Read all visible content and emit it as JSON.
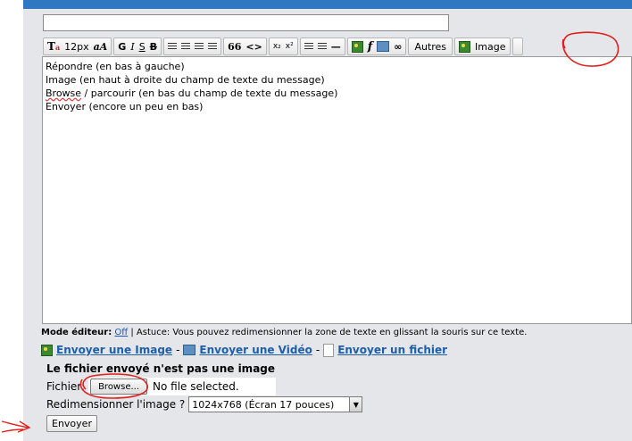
{
  "toolbar": {
    "font_size_label": "12px",
    "more_label": "Autres",
    "image_label": "Image",
    "quote_glyph": "66",
    "code_glyph": "<>",
    "subscript_glyph": "x₂",
    "superscript_glyph": "x²"
  },
  "editor": {
    "lines": [
      "Répondre (en bas à gauche)",
      "Image (en haut à droite du champ de texte du message)",
      "Browse",
      " / parcourir (en bas du champ de texte du message)",
      "Envoyer (encore un peu en bas)"
    ]
  },
  "astuce": {
    "mode_label": "Mode éditeur:",
    "mode_value": "Off",
    "tip_text": "| Astuce: Vous pouvez redimensionner la zone de texte en glissant la souris sur ce texte."
  },
  "send_links": {
    "image": "Envoyer une Image",
    "sep1": "-",
    "video": "Envoyer une Vidéo",
    "sep2": "-",
    "file": "Envoyer un fichier"
  },
  "upload": {
    "error_title": "Le fichier envoyé n'est pas une image",
    "file_label": "Fichier:",
    "browse_label": "Browse...",
    "no_file_text": "No file selected.",
    "resize_label": "Redimensionner l'image ?",
    "resize_value": "1024x768 (Écran 17 pouces)"
  },
  "submit_label": "Envoyer",
  "colors": {
    "header_blue": "#2f77c0",
    "panel_bg": "#e4e6ea",
    "link_blue": "#1e5fa8",
    "annotation_red": "#e0201c"
  }
}
